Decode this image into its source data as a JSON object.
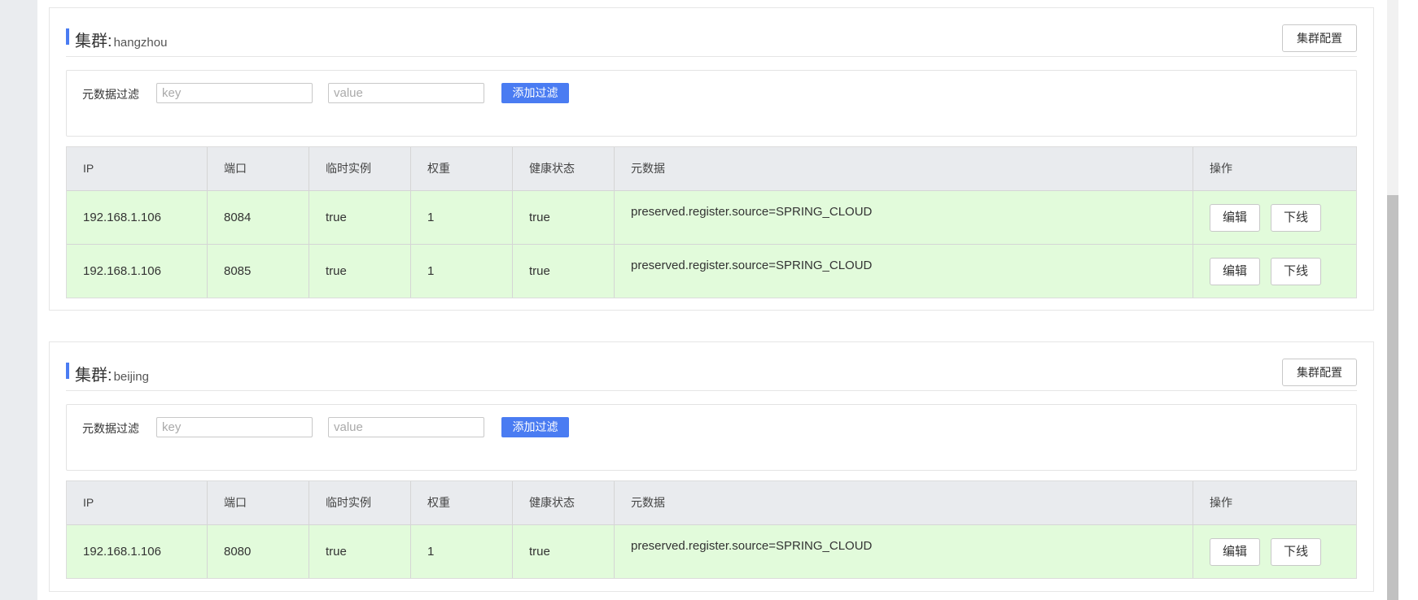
{
  "filter": {
    "label": "元数据过滤",
    "key_placeholder": "key",
    "value_placeholder": "value",
    "add_button": "添加过滤"
  },
  "table_headers": [
    "IP",
    "端口",
    "临时实例",
    "权重",
    "健康状态",
    "元数据",
    "操作"
  ],
  "actions": {
    "edit": "编辑",
    "offline": "下线"
  },
  "cluster_config_button": "集群配置",
  "cluster_title_prefix": "集群:",
  "clusters": [
    {
      "name": "hangzhou",
      "instances": [
        {
          "ip": "192.168.1.106",
          "port": "8084",
          "ephemeral": "true",
          "weight": "1",
          "healthy": "true",
          "metadata": "preserved.register.source=SPRING_CLOUD"
        },
        {
          "ip": "192.168.1.106",
          "port": "8085",
          "ephemeral": "true",
          "weight": "1",
          "healthy": "true",
          "metadata": "preserved.register.source=SPRING_CLOUD"
        }
      ]
    },
    {
      "name": "beijing",
      "instances": [
        {
          "ip": "192.168.1.106",
          "port": "8080",
          "ephemeral": "true",
          "weight": "1",
          "healthy": "true",
          "metadata": "preserved.register.source=SPRING_CLOUD"
        }
      ]
    }
  ],
  "colors": {
    "accent": "#4a7cf2",
    "row_healthy": "#e2fbdb",
    "table_header": "#e9ebee"
  }
}
